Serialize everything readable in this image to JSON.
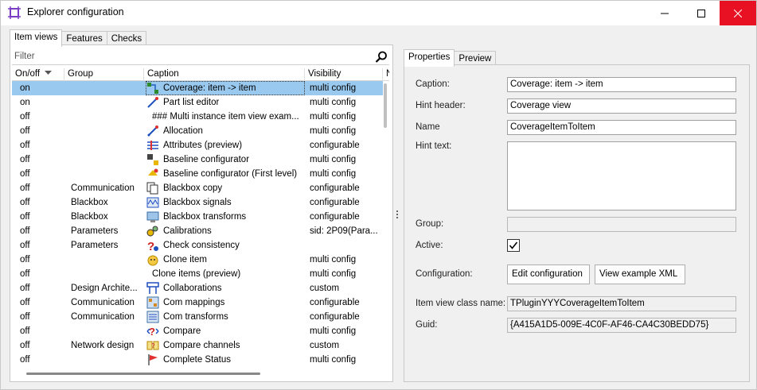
{
  "window": {
    "title": "Explorer configuration"
  },
  "left_tabs": [
    "Item views",
    "Features",
    "Checks"
  ],
  "filter": {
    "placeholder": "Filter"
  },
  "columns": {
    "onoff": "On/off",
    "group": "Group",
    "caption": "Caption",
    "visibility": "Visibility",
    "next": "N"
  },
  "rows": [
    {
      "onoff": "on",
      "group": "",
      "caption": "Coverage: item -> item",
      "visibility": "multi config",
      "icon": "coverage-icon",
      "selected": true
    },
    {
      "onoff": "on",
      "group": "",
      "caption": "Part list editor",
      "visibility": "multi config",
      "icon": "part-list-icon"
    },
    {
      "onoff": "off",
      "group": "",
      "caption": "### Multi instance item view exam...",
      "visibility": "multi config",
      "icon": ""
    },
    {
      "onoff": "off",
      "group": "",
      "caption": "Allocation",
      "visibility": "multi config",
      "icon": "allocation-icon"
    },
    {
      "onoff": "off",
      "group": "",
      "caption": "Attributes (preview)",
      "visibility": "configurable",
      "icon": "attributes-icon"
    },
    {
      "onoff": "off",
      "group": "",
      "caption": "Baseline configurator",
      "visibility": "multi config",
      "icon": "baseline-icon"
    },
    {
      "onoff": "off",
      "group": "",
      "caption": "Baseline configurator (First level)",
      "visibility": "multi config",
      "icon": "baseline-first-icon"
    },
    {
      "onoff": "off",
      "group": "Communication",
      "caption": "Blackbox copy",
      "visibility": "configurable",
      "icon": "copy-icon"
    },
    {
      "onoff": "off",
      "group": "Blackbox",
      "caption": "Blackbox signals",
      "visibility": "configurable",
      "icon": "signals-icon"
    },
    {
      "onoff": "off",
      "group": "Blackbox",
      "caption": "Blackbox transforms",
      "visibility": "configurable",
      "icon": "transforms-icon"
    },
    {
      "onoff": "off",
      "group": "Parameters",
      "caption": "Calibrations",
      "visibility": "sid: 2P09(Para...",
      "icon": "calibrations-icon"
    },
    {
      "onoff": "off",
      "group": "Parameters",
      "caption": "Check consistency",
      "visibility": "",
      "icon": "check-consistency-icon"
    },
    {
      "onoff": "off",
      "group": "",
      "caption": "Clone item",
      "visibility": "multi config",
      "icon": "clone-icon"
    },
    {
      "onoff": "off",
      "group": "",
      "caption": "Clone items (preview)",
      "visibility": "multi config",
      "icon": ""
    },
    {
      "onoff": "off",
      "group": "Design Archite...",
      "caption": "Collaborations",
      "visibility": "custom",
      "icon": "collaborations-icon"
    },
    {
      "onoff": "off",
      "group": "Communication",
      "caption": "Com mappings",
      "visibility": "configurable",
      "icon": "com-mappings-icon"
    },
    {
      "onoff": "off",
      "group": "Communication",
      "caption": "Com transforms",
      "visibility": "configurable",
      "icon": "com-transforms-icon"
    },
    {
      "onoff": "off",
      "group": "",
      "caption": "Compare",
      "visibility": "multi config",
      "icon": "compare-icon"
    },
    {
      "onoff": "off",
      "group": "Network design",
      "caption": "Compare channels",
      "visibility": "custom",
      "icon": "compare-channels-icon"
    },
    {
      "onoff": "off",
      "group": "",
      "caption": "Complete Status",
      "visibility": "multi config",
      "icon": "flag-icon"
    }
  ],
  "right_tabs": [
    "Properties",
    "Preview"
  ],
  "properties": {
    "caption_label": "Caption:",
    "caption_value": "Coverage: item -> item",
    "hint_header_label": "Hint header:",
    "hint_header_value": "Coverage view",
    "name_label": "Name",
    "name_value": "CoverageItemToItem",
    "hint_text_label": "Hint text:",
    "hint_text_value": "",
    "group_label": "Group:",
    "group_value": "",
    "active_label": "Active:",
    "configuration_label": "Configuration:",
    "edit_configuration": "Edit configuration",
    "view_example_xml": "View example XML",
    "class_name_label": "Item view class name:",
    "class_name_value": "TPluginYYYCoverageItemToItem",
    "guid_label": "Guid:",
    "guid_value": "{A415A1D5-009E-4C0F-AF46-CA4C30BEDD75}"
  },
  "colors": {
    "selection": "#99c9ef",
    "close_hover": "#e81123",
    "accent_red": "#e03030"
  }
}
